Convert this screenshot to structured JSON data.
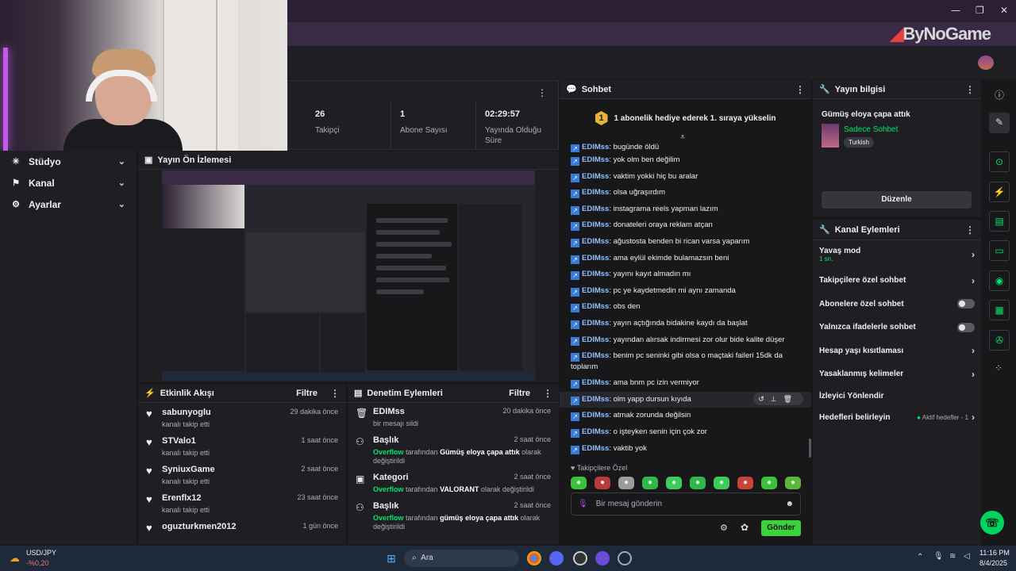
{
  "window": {
    "minimize": "—",
    "restore": "❐",
    "close": "✕"
  },
  "brand": {
    "logo_prefix": "",
    "logo_text": "ByNoGame"
  },
  "sidebar": {
    "items": [
      {
        "icon": "✳",
        "label": "Stüdyo"
      },
      {
        "icon": "⚑",
        "label": "Kanal"
      },
      {
        "icon": "⚙",
        "label": "Ayarlar"
      }
    ]
  },
  "stats": [
    {
      "value": "26",
      "label": "Takipçi"
    },
    {
      "value": "1",
      "label": "Abone Sayısı"
    },
    {
      "value": "02:29:57",
      "label": "Yayında Olduğu Süre"
    }
  ],
  "preview": {
    "title": "Yayın Ön İzlemesi"
  },
  "activity": {
    "title": "Etkinlik Akışı",
    "filter": "Filtre",
    "items": [
      {
        "name": "sabunyoglu",
        "sub": "kanalı takip etti",
        "time": "29 dakika önce"
      },
      {
        "name": "STValo1",
        "sub": "kanalı takip etti",
        "time": "1 saat önce"
      },
      {
        "name": "SyniuxGame",
        "sub": "kanalı takip etti",
        "time": "2 saat önce"
      },
      {
        "name": "Erenflx12",
        "sub": "kanalı takip etti",
        "time": "23 saat önce"
      },
      {
        "name": "oguzturkmen2012",
        "sub": "",
        "time": "1 gün önce"
      }
    ]
  },
  "moderation": {
    "title": "Denetim Eylemleri",
    "filter": "Filtre",
    "items": [
      {
        "icon": "🗑",
        "name": "EDIMss",
        "time": "20 dakika önce",
        "actor": "",
        "mid": "bir mesajı sildi",
        "value": "",
        "end": ""
      },
      {
        "icon": "⚇",
        "name": "Başlık",
        "time": "2 saat önce",
        "actor": "Overflow",
        "mid": " tarafından ",
        "value": "Gümüş eloya çapa attık",
        "end": " olarak değiştirildi"
      },
      {
        "icon": "▣",
        "name": "Kategori",
        "time": "2 saat önce",
        "actor": "Overflow",
        "mid": " tarafından ",
        "value": "VALORANT",
        "end": " olarak değiştirildi"
      },
      {
        "icon": "⚇",
        "name": "Başlık",
        "time": "2 saat önce",
        "actor": "Overflow",
        "mid": " tarafından ",
        "value": "gümüş eloya çapa attık",
        "end": " olarak değiştirildi"
      }
    ]
  },
  "chat": {
    "title": "Sohbet",
    "pinned_badge": "1",
    "pinned_text": "1 abonelik hediye ederek 1. sıraya yükselin",
    "messages": [
      {
        "user": "EDIMss",
        "text": "bugünde öldü"
      },
      {
        "user": "EDIMss",
        "text": "yok olm ben değilim"
      },
      {
        "user": "EDIMss",
        "text": "vaktim yokki hiç bu aralar"
      },
      {
        "user": "EDIMss",
        "text": "olsa uğraşırdım"
      },
      {
        "user": "EDIMss",
        "text": "instagrama reels yapman lazım"
      },
      {
        "user": "EDIMss",
        "text": "donateleri oraya reklam atçan"
      },
      {
        "user": "EDIMss",
        "text": "ağustosta benden bi rican varsa yaparım"
      },
      {
        "user": "EDIMss",
        "text": "ama eylül ekimde bulamazsın beni"
      },
      {
        "user": "EDIMss",
        "text": "yayını kayıt almadın mı"
      },
      {
        "user": "EDIMss",
        "text": "pc ye kaydetmedin mi aynı zamanda"
      },
      {
        "user": "EDIMss",
        "text": "obs den"
      },
      {
        "user": "EDIMss",
        "text": "yayın açtığında bidakine kaydı da başlat"
      },
      {
        "user": "EDIMss",
        "text": "yayından alırsak indirmesi zor olur bide kalite düşer"
      },
      {
        "user": "EDIMss",
        "text": "benim pc seninki gibi olsa o maçtaki faileri 15dk da toplarım"
      },
      {
        "user": "EDIMss",
        "text": "ama bnm pc izin vermiyor"
      },
      {
        "user": "EDIMss",
        "text": "olm yapp dursun kıyıda"
      },
      {
        "user": "EDIMss",
        "text": "atmak zorunda değilsin"
      },
      {
        "user": "EDIMss",
        "text": "o işteyken senin için çok zor"
      },
      {
        "user": "EDIMss",
        "text": "vaktib yok"
      }
    ],
    "followers_only": "Takipçilere Özel",
    "input_placeholder": "Bir mesaj gönderin",
    "send": "Gönder"
  },
  "stream_info": {
    "title": "Yayın bilgisi",
    "stream_title": "Gümüş eloya çapa attık",
    "category": "Sadece Sohbet",
    "tag": "Turkish",
    "edit": "Düzenle"
  },
  "channel_actions": {
    "title": "Kanal Eylemleri",
    "slow_mode": "Yavaş mod",
    "slow_value": "1 sn.",
    "followers_chat": "Takipçilere özel sohbet",
    "subs_chat": "Abonelere özel sohbet",
    "emote_chat": "Yalnızca ifadelerle sohbet",
    "age": "Hesap yaşı kısıtlaması",
    "banned_words": "Yasaklanmış kelimeler",
    "redirect": "İzleyici Yönlendir",
    "goals": "Hedefleri belirleyin",
    "goals_status": "Aktif hedefler - 1"
  },
  "taskbar": {
    "ticker": "USD/JPY",
    "ticker_change": "-%0,20",
    "search": "Ara",
    "time": "11:16 PM",
    "date": "8/4/2025"
  },
  "colors": {
    "accent": "#00e66b",
    "link": "#8fc0ff",
    "bg": "#18181b",
    "panel": "#1f1f23"
  }
}
